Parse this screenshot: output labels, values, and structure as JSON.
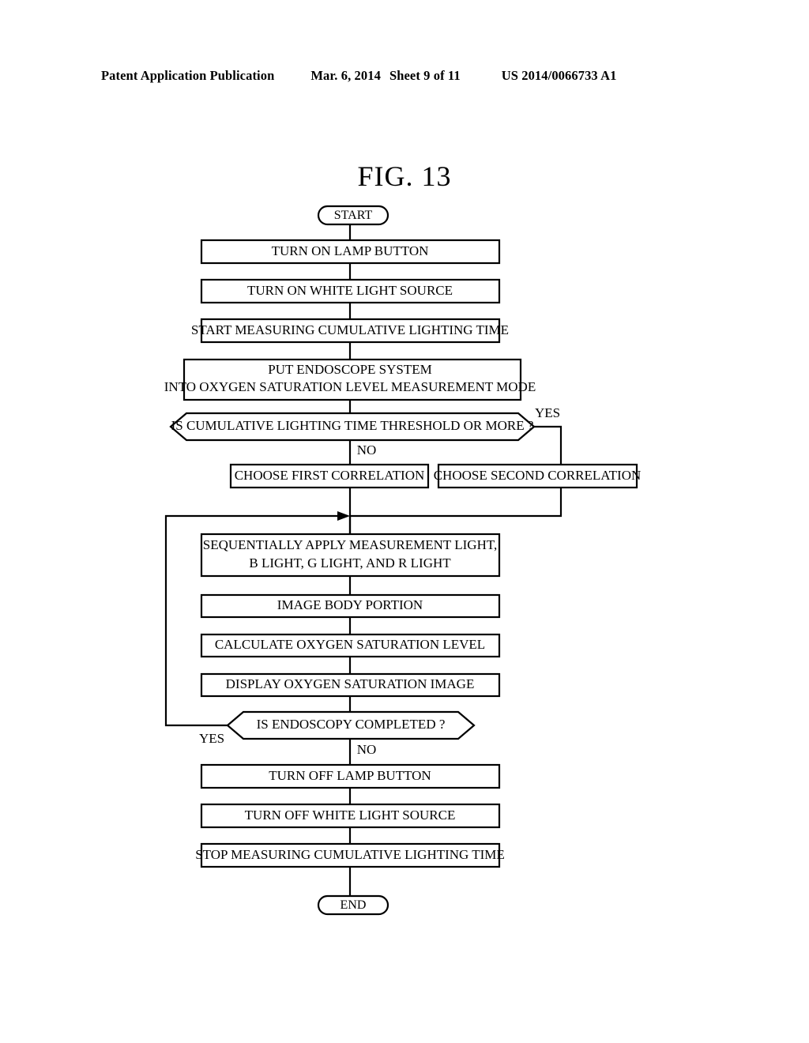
{
  "header": {
    "publication": "Patent Application Publication",
    "date": "Mar. 6, 2014",
    "sheet": "Sheet 9 of 11",
    "patent_number": "US 2014/0066733 A1"
  },
  "figure": {
    "label": "FIG. 13"
  },
  "chart_data": {
    "type": "diagram",
    "diagram_type": "flowchart",
    "title": "FIG. 13",
    "orientation": "top-to-bottom",
    "nodes": [
      {
        "id": "start",
        "shape": "terminator",
        "text": "START"
      },
      {
        "id": "lamp_on",
        "shape": "process",
        "text": "TURN ON LAMP BUTTON"
      },
      {
        "id": "white_on",
        "shape": "process",
        "text": "TURN ON WHITE LIGHT SOURCE"
      },
      {
        "id": "start_meas",
        "shape": "process",
        "text": "START MEASURING CUMULATIVE LIGHTING TIME"
      },
      {
        "id": "mode",
        "shape": "process",
        "text_line1": "PUT ENDOSCOPE SYSTEM",
        "text_line2": "INTO OXYGEN SATURATION LEVEL MEASUREMENT MODE"
      },
      {
        "id": "dec_thresh",
        "shape": "decision",
        "text": "IS CUMULATIVE LIGHTING TIME THRESHOLD OR MORE ?"
      },
      {
        "id": "corr_first",
        "shape": "process",
        "text": "CHOOSE FIRST CORRELATION"
      },
      {
        "id": "corr_second",
        "shape": "process",
        "text": "CHOOSE SECOND CORRELATION"
      },
      {
        "id": "apply_light",
        "shape": "process",
        "text_line1": "SEQUENTIALLY APPLY MEASUREMENT LIGHT,",
        "text_line2": "B LIGHT, G LIGHT, AND R LIGHT"
      },
      {
        "id": "image_body",
        "shape": "process",
        "text": "IMAGE BODY PORTION"
      },
      {
        "id": "calc_sat",
        "shape": "process",
        "text": "CALCULATE OXYGEN SATURATION LEVEL"
      },
      {
        "id": "display_img",
        "shape": "process",
        "text": "DISPLAY OXYGEN SATURATION IMAGE"
      },
      {
        "id": "dec_done",
        "shape": "decision",
        "text": "IS ENDOSCOPY COMPLETED ?"
      },
      {
        "id": "lamp_off",
        "shape": "process",
        "text": "TURN OFF LAMP BUTTON"
      },
      {
        "id": "white_off",
        "shape": "process",
        "text": "TURN OFF WHITE LIGHT SOURCE"
      },
      {
        "id": "stop_meas",
        "shape": "process",
        "text": "STOP MEASURING CUMULATIVE LIGHTING TIME"
      },
      {
        "id": "end",
        "shape": "terminator",
        "text": "END"
      }
    ],
    "edges": [
      {
        "from": "start",
        "to": "lamp_on",
        "label": ""
      },
      {
        "from": "lamp_on",
        "to": "white_on",
        "label": ""
      },
      {
        "from": "white_on",
        "to": "start_meas",
        "label": ""
      },
      {
        "from": "start_meas",
        "to": "mode",
        "label": ""
      },
      {
        "from": "mode",
        "to": "dec_thresh",
        "label": ""
      },
      {
        "from": "dec_thresh",
        "to": "corr_first",
        "label": "NO"
      },
      {
        "from": "dec_thresh",
        "to": "corr_second",
        "label": "YES"
      },
      {
        "from": "corr_first",
        "to": "apply_light",
        "label": ""
      },
      {
        "from": "corr_second",
        "to": "apply_light",
        "label": ""
      },
      {
        "from": "apply_light",
        "to": "image_body",
        "label": ""
      },
      {
        "from": "image_body",
        "to": "calc_sat",
        "label": ""
      },
      {
        "from": "calc_sat",
        "to": "display_img",
        "label": ""
      },
      {
        "from": "display_img",
        "to": "dec_done",
        "label": ""
      },
      {
        "from": "dec_done",
        "to": "apply_light",
        "label": "YES"
      },
      {
        "from": "dec_done",
        "to": "lamp_off",
        "label": "NO"
      },
      {
        "from": "lamp_off",
        "to": "white_off",
        "label": ""
      },
      {
        "from": "white_off",
        "to": "stop_meas",
        "label": ""
      },
      {
        "from": "stop_meas",
        "to": "end",
        "label": ""
      }
    ],
    "branch_labels": {
      "thresh_yes": "YES",
      "thresh_no": "NO",
      "done_yes": "YES",
      "done_no": "NO"
    },
    "colors": {
      "stroke": "#000000",
      "fill": "#ffffff",
      "text": "#000000"
    }
  }
}
